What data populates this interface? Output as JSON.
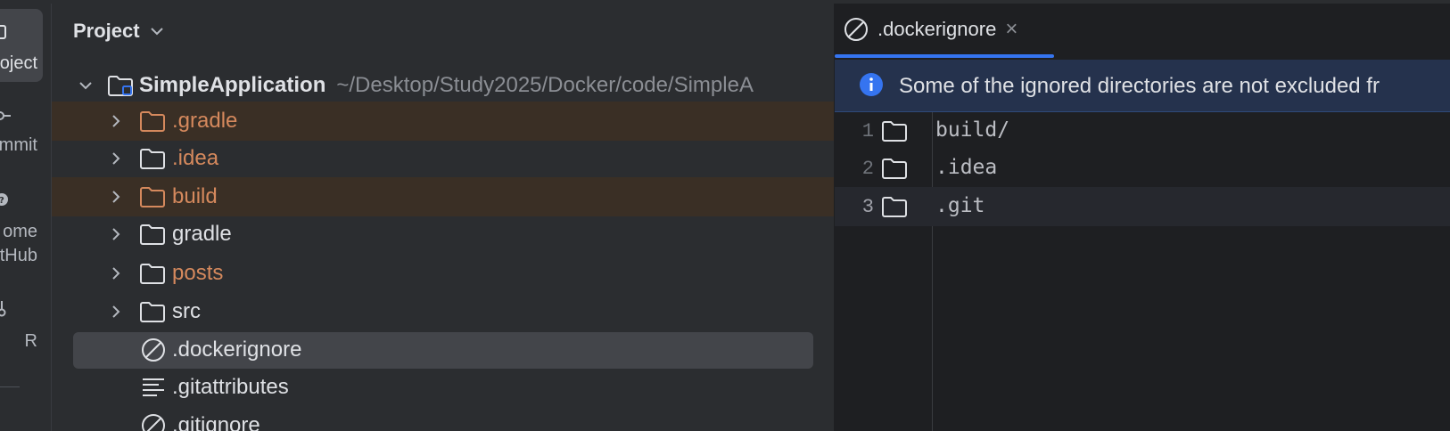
{
  "left_strip": {
    "items": [
      {
        "label": "oject",
        "icon": "folder-icon",
        "active": true
      },
      {
        "label": "mmit",
        "icon": "commit-icon"
      },
      {
        "label": "ome",
        "label2": "tHub",
        "icon": "github-icon"
      },
      {
        "label": "R",
        "icon": "pull-request-icon"
      }
    ]
  },
  "project_panel": {
    "title": "Project",
    "root": {
      "name": "SimpleApplication",
      "path": "~/Desktop/Study2025/Docker/code/SimpleA"
    },
    "items": [
      {
        "label": ".gradle",
        "type": "folder",
        "color": "#d5895d",
        "highlight": true
      },
      {
        "label": ".idea",
        "type": "folder",
        "color": "#d5895d"
      },
      {
        "label": "build",
        "type": "folder",
        "color": "#d5895d",
        "highlight": true
      },
      {
        "label": "gradle",
        "type": "folder",
        "color": "#dfe1e5"
      },
      {
        "label": "posts",
        "type": "folder",
        "color": "#d5895d"
      },
      {
        "label": "src",
        "type": "folder",
        "color": "#dfe1e5"
      },
      {
        "label": ".dockerignore",
        "type": "ignore-file",
        "selected": true
      },
      {
        "label": ".gitattributes",
        "type": "text-file"
      },
      {
        "label": ".gitignore",
        "type": "ignore-file"
      }
    ]
  },
  "editor": {
    "tab": {
      "label": ".dockerignore",
      "close": "×"
    },
    "banner": {
      "text": "Some of the ignored directories are not excluded fr"
    },
    "lines": [
      {
        "num": "1",
        "text": "build/"
      },
      {
        "num": "2",
        "text": ".idea"
      },
      {
        "num": "3",
        "text": ".git",
        "current": true
      }
    ]
  },
  "colors": {
    "accent": "#3574f0",
    "folder_ignored": "#d5895d",
    "highlight_bg": "#3a2f25"
  }
}
